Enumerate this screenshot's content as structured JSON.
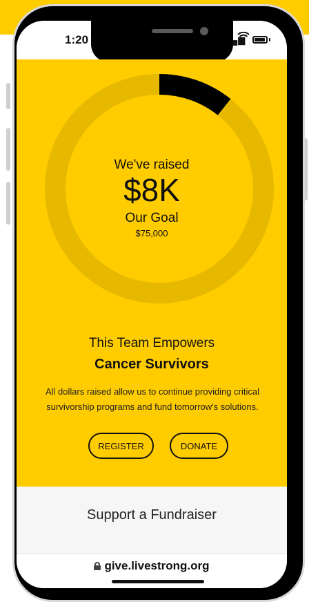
{
  "status_bar": {
    "time": "1:20",
    "signal_icon": "signal-bars-icon",
    "wifi_icon": "wifi-icon",
    "battery_icon": "battery-icon"
  },
  "progress": {
    "raised_label": "We've raised",
    "raised_amount": "$8K",
    "goal_label": "Our Goal",
    "goal_amount": "$75,000",
    "raised_value": 8000,
    "goal_value": 75000,
    "fraction": 0.107,
    "colors": {
      "track": "#e6b800",
      "fill": "#000000",
      "background": "#ffcc00"
    }
  },
  "team": {
    "line1": "This Team Empowers",
    "line2": "Cancer Survivors",
    "description": "All dollars raised allow us to continue providing critical survivorship programs and fund tomorrow's solutions."
  },
  "buttons": {
    "register": "REGISTER",
    "donate": "DONATE"
  },
  "support": {
    "title": "Support a Fundraiser"
  },
  "browser": {
    "url": "give.livestrong.org",
    "lock_icon": "lock-icon"
  }
}
